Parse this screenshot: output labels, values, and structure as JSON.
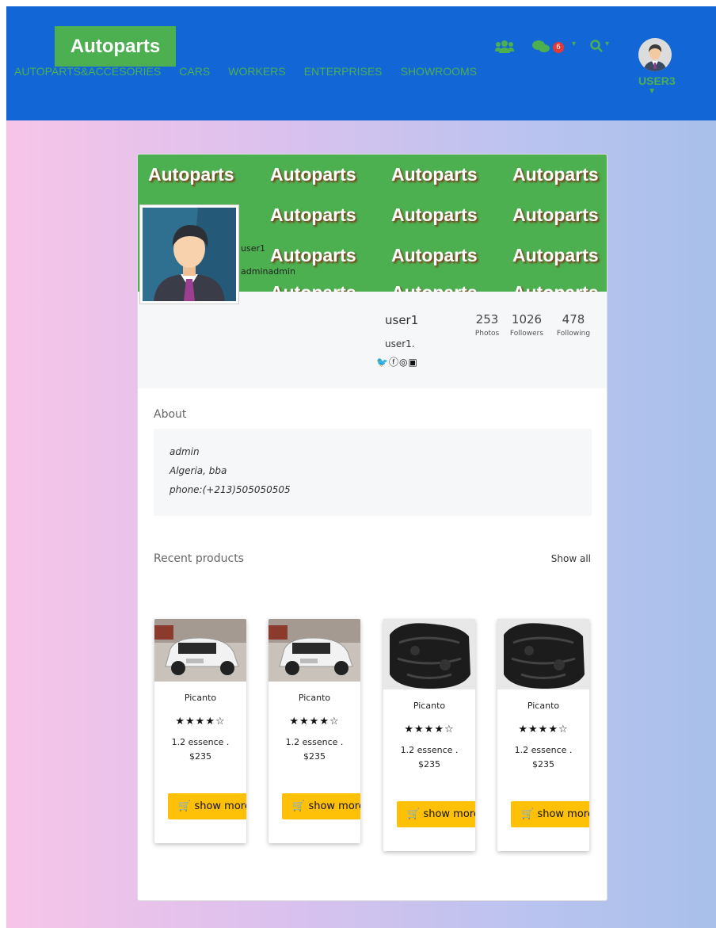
{
  "navbar": {
    "brand": "Autoparts",
    "links": [
      "AUTOPARTS&ACCESORIES",
      "CARS",
      "WORKERS",
      "ENTERPRISES",
      "SHOWROOMS"
    ],
    "notification_count": "6",
    "user_label": "USER3",
    "icons": [
      "users-icon",
      "comments-icon",
      "search-icon"
    ]
  },
  "banner": {
    "repeat_text": "Autoparts"
  },
  "profile": {
    "overlay_name": "user1",
    "overlay_username": "adminadmin",
    "name": "user1",
    "handle": "user1.",
    "social_icons": [
      "twitter-icon",
      "facebook-icon",
      "instagram-icon",
      "linkedin-icon"
    ],
    "stats": [
      {
        "value": "253",
        "label": "Photos"
      },
      {
        "value": "1026",
        "label": "Followers"
      },
      {
        "value": "478",
        "label": "Following"
      }
    ]
  },
  "about": {
    "title": "About",
    "lines": [
      "admin",
      "Algeria, bba",
      "phone:(+213)505050505"
    ]
  },
  "recent": {
    "title": "Recent products",
    "show_all": "Show all",
    "products": [
      {
        "name": "Picanto",
        "rating": 4,
        "stars": "★★★★☆",
        "desc": "1.2 essence .",
        "price": "$235",
        "button": "show more",
        "image": "car"
      },
      {
        "name": "Picanto",
        "rating": 4,
        "stars": "★★★★☆",
        "desc": "1.2 essence .",
        "price": "$235",
        "button": "show more",
        "image": "car"
      },
      {
        "name": "Picanto",
        "rating": 4,
        "stars": "★★★★☆",
        "desc": "1.2 essence .",
        "price": "$235",
        "button": "show more",
        "image": "engine"
      },
      {
        "name": "Picanto",
        "rating": 4,
        "stars": "★★★★☆",
        "desc": "1.2 essence .",
        "price": "$235",
        "button": "show more",
        "image": "engine"
      }
    ]
  },
  "colors": {
    "navbar": "#1266d6",
    "brand_green": "#4caf50",
    "button_yellow": "#ffc107",
    "badge_red": "#e53935"
  }
}
